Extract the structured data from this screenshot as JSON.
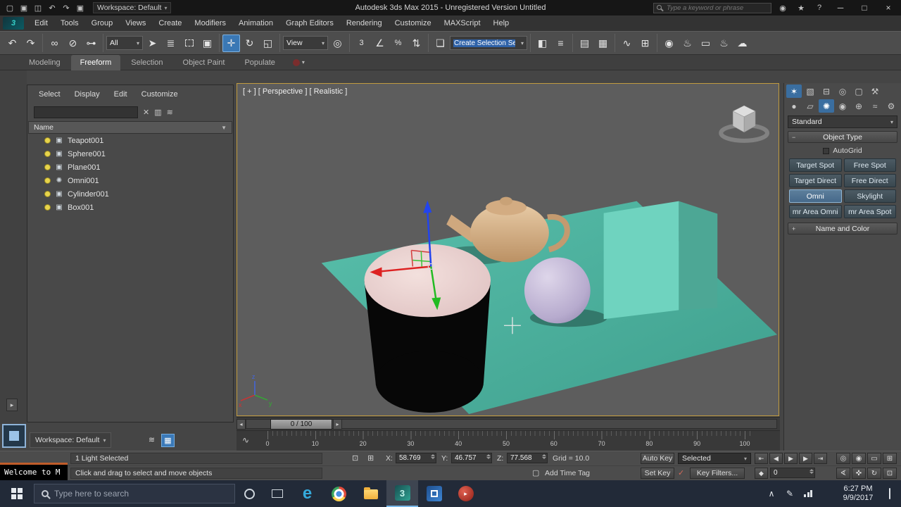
{
  "titlebar": {
    "title": "Autodesk 3ds Max 2015  - Unregistered Version   Untitled",
    "workspace": "Workspace: Default",
    "search_placeholder": "Type a keyword or phrase"
  },
  "menus": [
    "Edit",
    "Tools",
    "Group",
    "Views",
    "Create",
    "Modifiers",
    "Animation",
    "Graph Editors",
    "Rendering",
    "Customize",
    "MAXScript",
    "Help"
  ],
  "toolbar": {
    "filter": "All",
    "coord_system": "View",
    "named_selection": "Create Selection Se"
  },
  "ribbon": {
    "tabs": [
      "Modeling",
      "Freeform",
      "Selection",
      "Object Paint",
      "Populate"
    ]
  },
  "scene_explorer": {
    "menu": [
      "Select",
      "Display",
      "Edit",
      "Customize"
    ],
    "column": "Name",
    "items": [
      {
        "label": "Teapot001",
        "icon": "▣"
      },
      {
        "label": "Sphere001",
        "icon": "▣"
      },
      {
        "label": "Plane001",
        "icon": "▣"
      },
      {
        "label": "Omni001",
        "icon": "✺"
      },
      {
        "label": "Cylinder001",
        "icon": "▣"
      },
      {
        "label": "Box001",
        "icon": "▣"
      }
    ]
  },
  "viewport": {
    "label": "[ + ] [ Perspective ] [ Realistic ]"
  },
  "command_panel": {
    "renderer": "Standard",
    "object_type": "Object Type",
    "autogrid": "AutoGrid",
    "buttons": [
      "Target Spot",
      "Free Spot",
      "Target Direct",
      "Free Direct",
      "Omni",
      "Skylight",
      "mr Area Omni",
      "mr Area Spot"
    ],
    "name_and_color": "Name and Color"
  },
  "timeline": {
    "handle": "0 / 100",
    "ticks": [
      "0",
      "10",
      "20",
      "30",
      "40",
      "50",
      "60",
      "70",
      "80",
      "90",
      "100"
    ]
  },
  "statusbar": {
    "welcome": "Welcome to M",
    "selection": "1 Light Selected",
    "prompt": "Click and drag to select and move objects",
    "x_label": "X:",
    "x_value": "58.769",
    "y_label": "Y:",
    "y_value": "46.757",
    "z_label": "Z:",
    "z_value": "77.568",
    "grid": "Grid = 10.0",
    "add_time_tag": "Add Time Tag",
    "auto_key": "Auto Key",
    "selected": "Selected",
    "set_key": "Set Key",
    "key_filters": "Key Filters...",
    "frame": "0"
  },
  "bottombar": {
    "workspace": "Workspace: Default"
  },
  "taskbar": {
    "search": "Type here to search",
    "time": "6:27 PM",
    "date": "9/9/2017"
  },
  "icons": {
    "app": "3",
    "caret": "▾",
    "col_caret": "▼",
    "qat_new": "▢",
    "qat_open": "▣",
    "qat_save": "◫",
    "undo": "↶",
    "redo": "↷",
    "star": "★",
    "help": "?",
    "community": "◉",
    "min": "─",
    "max": "□",
    "close": "×",
    "link": "∞",
    "unlink": "⊘",
    "bind": "⊶",
    "select": "➤",
    "select_by_name": "≣",
    "window_crossing": "▣",
    "move": "✛",
    "rotate": "↻",
    "scale": "◱",
    "use_center": "◎",
    "snap3": "3",
    "angle_snap": "∠",
    "percent_snap": "%",
    "spinner_snap": "⇅",
    "named_sets": "❏",
    "mirror": "◧",
    "align": "≡",
    "layers": "▤",
    "ribbon_toggle": "▦",
    "curve_editor": "∿",
    "schematic": "⊞",
    "material": "◉",
    "render_setup": "♨",
    "rfw": "▭",
    "render": "♨",
    "cloud": "☁",
    "se_clear": "✕",
    "se_filter": "▥",
    "se_options": "≋",
    "expand": "▸",
    "tab_create": "✶",
    "tab_modify": "▧",
    "tab_hierarchy": "⊟",
    "tab_motion": "◎",
    "tab_display": "▢",
    "tab_utilities": "⚒",
    "cat_geometry": "●",
    "cat_shapes": "▱",
    "cat_lights": "✺",
    "cat_cameras": "◉",
    "cat_helpers": "⊕",
    "cat_spacewarps": "≈",
    "cat_systems": "⚙",
    "minus": "−",
    "plus": "+",
    "mini_curve": "∿",
    "track_left": "◂",
    "track_right": "▸",
    "waves": "≋",
    "grid_btn": "▦",
    "lock": "⊡",
    "absolute": "⊞",
    "go_start": "⇤",
    "frame_back": "◀",
    "play": "▶",
    "frame_fwd": "▶",
    "go_end": "⇥",
    "zoom": "◎",
    "zoom_all": "◉",
    "extents": "▭",
    "extents_all": "⊞",
    "fov": "∢",
    "pan": "✜",
    "orbit": "↻",
    "maximize": "⊡",
    "key_mode": "◆",
    "check": "✓",
    "tag_box": "▢",
    "caret_up": "∧",
    "pen": "✎",
    "play_small": "▸"
  }
}
